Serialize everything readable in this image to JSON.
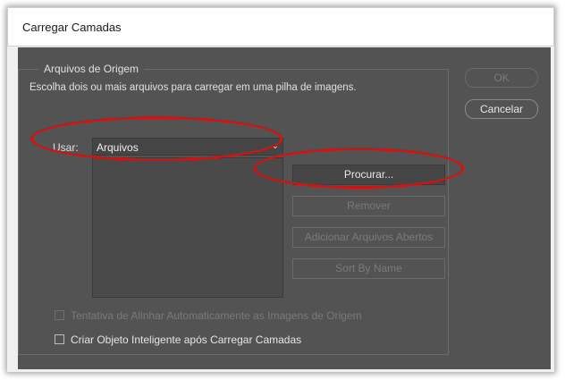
{
  "window": {
    "title": "Carregar Camadas"
  },
  "source_group": {
    "title": "Arquivos de Origem",
    "description": "Escolha dois ou mais arquivos para carregar em uma pilha de imagens.",
    "use_label": "Usar:",
    "use_value": "Arquivos"
  },
  "buttons": {
    "browse": "Procurar...",
    "remove": "Remover",
    "add_open_files": "Adicionar Arquivos Abertos",
    "sort_by_name": "Sort By Name",
    "ok": "OK",
    "cancel": "Cancelar"
  },
  "options": {
    "auto_align": "Tentativa de Alinhar Automaticamente as Imagens de Origem",
    "smart_object": "Criar Objeto Inteligente após Carregar Camadas"
  },
  "colors": {
    "highlight_ring": "#cc1515",
    "panel": "#535353"
  }
}
